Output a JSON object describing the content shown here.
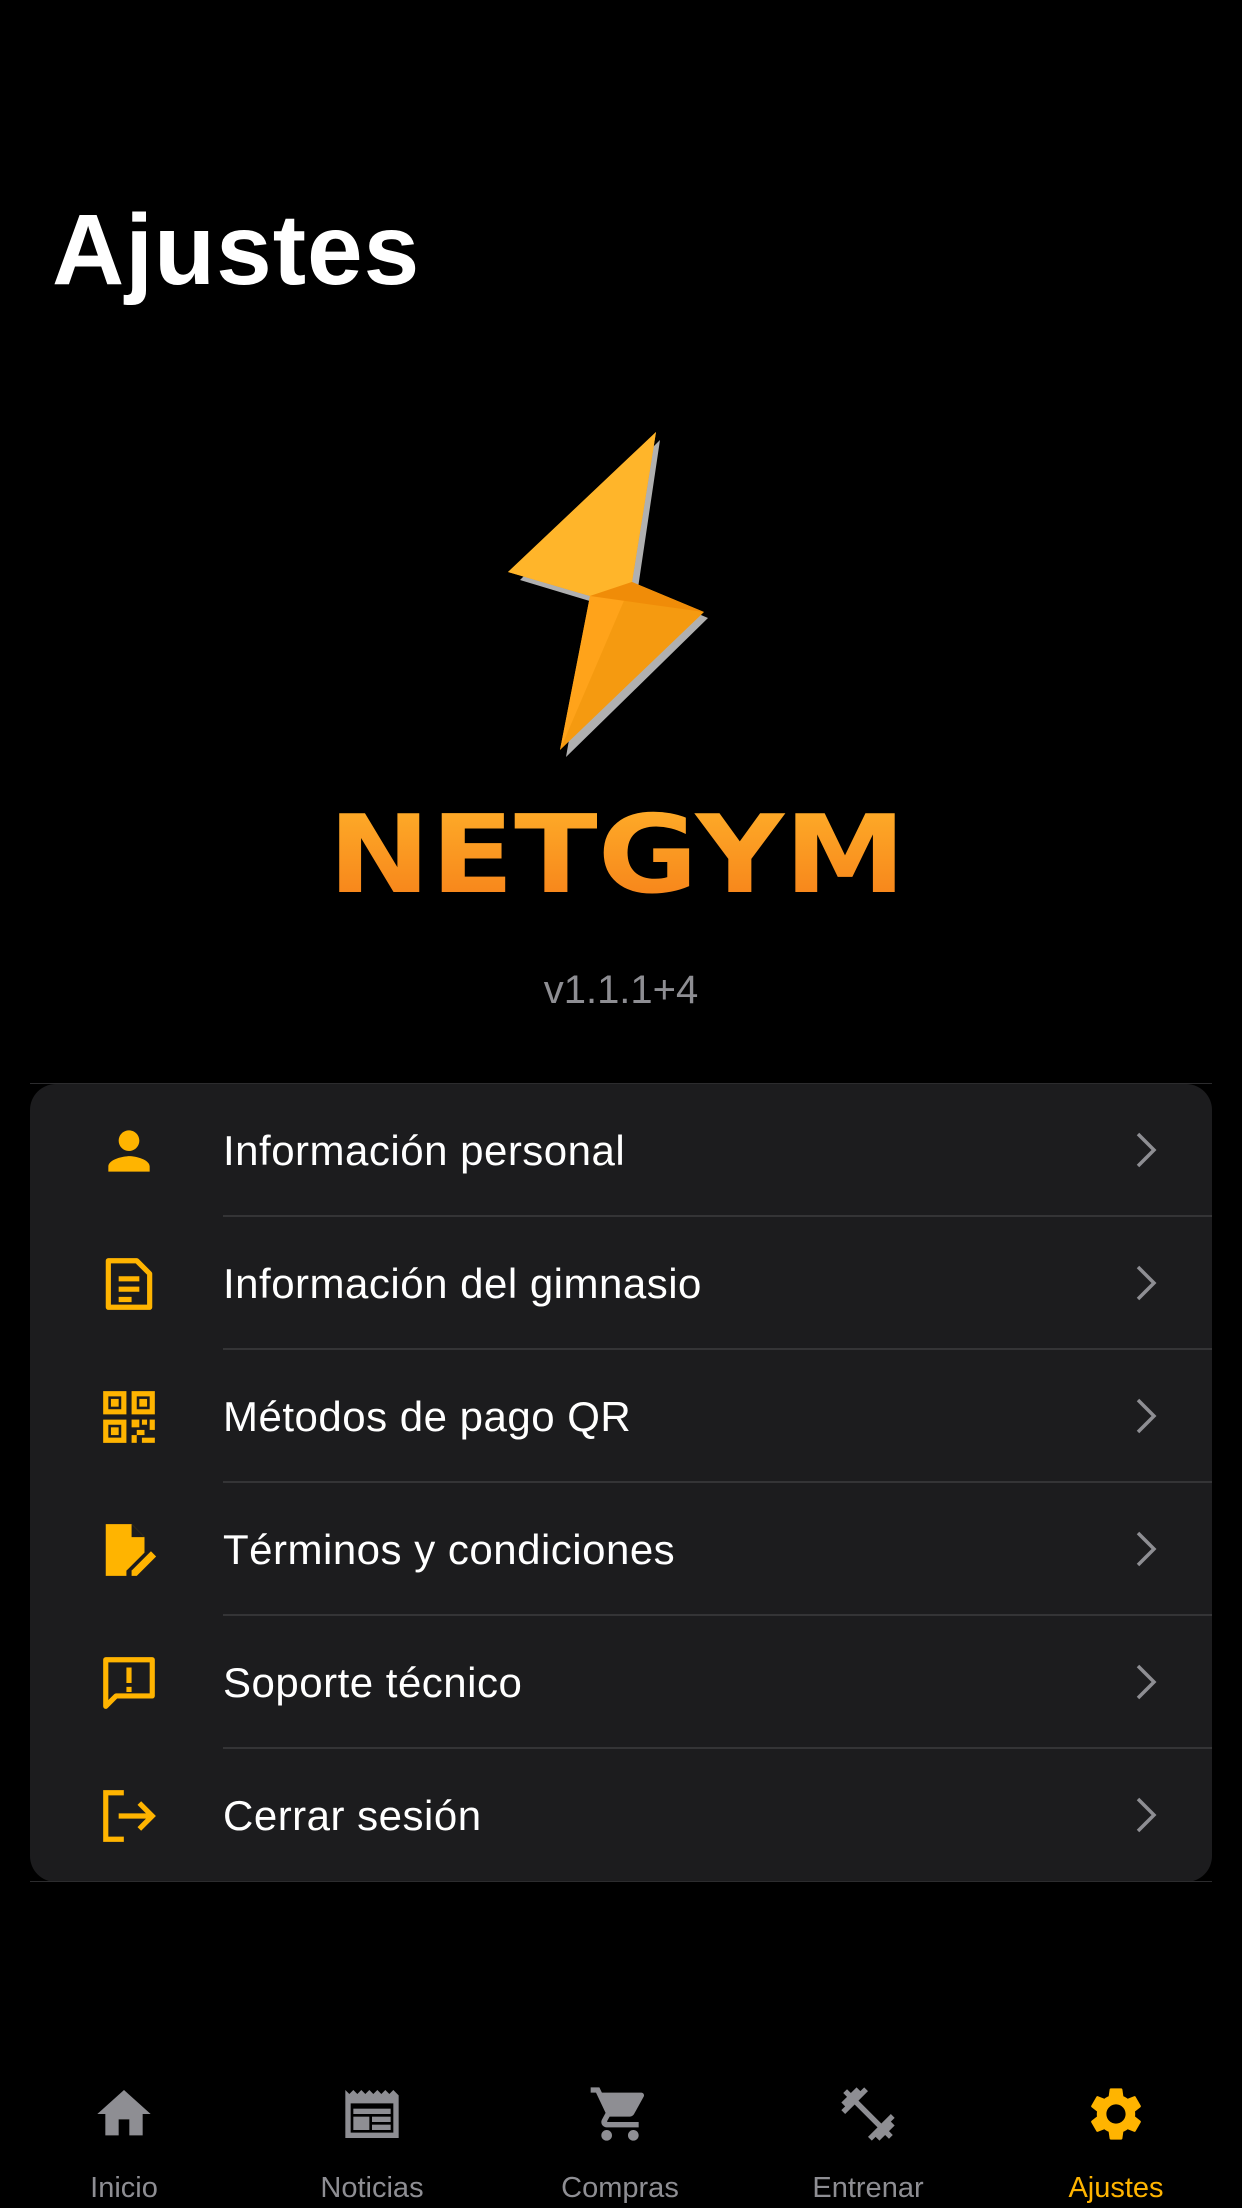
{
  "header": {
    "title": "Ajustes"
  },
  "logo": {
    "brand": "NETGYM"
  },
  "app": {
    "version": "v1.1.1+4"
  },
  "colors": {
    "accent": "#ffb400",
    "background": "#000000",
    "card": "#1c1c1e",
    "inactive": "#8e8e93"
  },
  "menu": {
    "items": [
      {
        "label": "Información personal",
        "icon": "person-icon"
      },
      {
        "label": "Información del gimnasio",
        "icon": "document-icon"
      },
      {
        "label": "Métodos de pago QR",
        "icon": "qr-code-icon"
      },
      {
        "label": "Términos y condiciones",
        "icon": "document-edit-icon"
      },
      {
        "label": "Soporte técnico",
        "icon": "feedback-icon"
      },
      {
        "label": "Cerrar sesión",
        "icon": "logout-icon"
      }
    ]
  },
  "tabs": [
    {
      "label": "Inicio",
      "icon": "home-icon",
      "active": false
    },
    {
      "label": "Noticias",
      "icon": "newspaper-icon",
      "active": false
    },
    {
      "label": "Compras",
      "icon": "cart-icon",
      "active": false
    },
    {
      "label": "Entrenar",
      "icon": "dumbbell-icon",
      "active": false
    },
    {
      "label": "Ajustes",
      "icon": "gear-icon",
      "active": true
    }
  ]
}
